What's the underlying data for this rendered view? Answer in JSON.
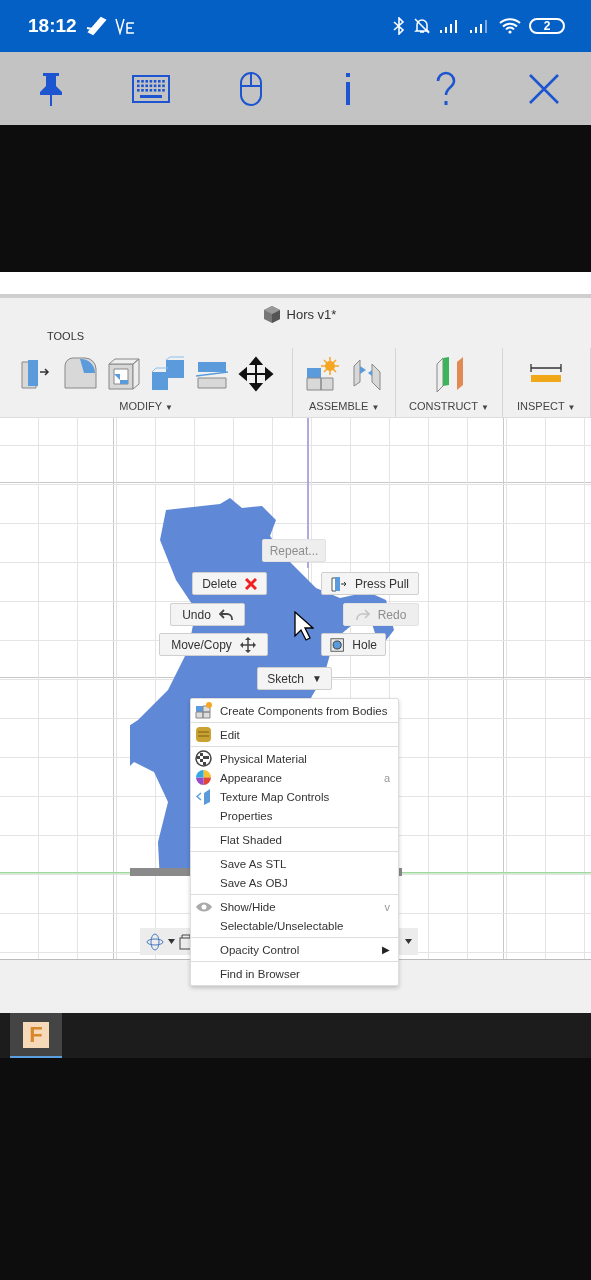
{
  "status_bar": {
    "time": "18:12",
    "battery": "2"
  },
  "app": {
    "title": "Hors v1*",
    "tab": "TOOLS",
    "groups": [
      {
        "label": "MODIFY",
        "caret": "▼"
      },
      {
        "label": "ASSEMBLE",
        "caret": "▼"
      },
      {
        "label": "CONSTRUCT",
        "caret": "▼"
      },
      {
        "label": "INSPECT",
        "caret": "▼"
      }
    ]
  },
  "marking_menu": [
    {
      "label": "Repeat...",
      "kind": "repeat",
      "disabled": true
    },
    {
      "label": "Delete",
      "kind": "delete",
      "disabled": false
    },
    {
      "label": "Press Pull",
      "kind": "press_pull",
      "disabled": false
    },
    {
      "label": "Undo",
      "kind": "undo",
      "disabled": false
    },
    {
      "label": "Redo",
      "kind": "redo",
      "disabled": true
    },
    {
      "label": "Move/Copy",
      "kind": "move",
      "disabled": false
    },
    {
      "label": "Hole",
      "kind": "hole",
      "disabled": false
    },
    {
      "label": "Sketch",
      "kind": "sketch",
      "disabled": false,
      "caret": "▼"
    }
  ],
  "context_menu": [
    [
      {
        "label": "Create Components from Bodies",
        "kind": "components"
      }
    ],
    [
      {
        "label": "Edit",
        "kind": "edit"
      }
    ],
    [
      {
        "label": "Physical Material",
        "kind": "material"
      },
      {
        "label": "Appearance",
        "kind": "appearance",
        "shortcut": "a"
      },
      {
        "label": "Texture Map Controls",
        "kind": "texture"
      },
      {
        "label": "Properties",
        "kind": "plain"
      }
    ],
    [
      {
        "label": "Flat Shaded",
        "kind": "plain"
      }
    ],
    [
      {
        "label": "Save As STL",
        "kind": "plain"
      },
      {
        "label": "Save As OBJ",
        "kind": "plain"
      }
    ],
    [
      {
        "label": "Show/Hide",
        "kind": "eye",
        "shortcut": "v"
      },
      {
        "label": "Selectable/Unselectable",
        "kind": "plain"
      }
    ],
    [
      {
        "label": "Opacity Control",
        "kind": "plain",
        "submenu": "▶"
      }
    ],
    [
      {
        "label": "Find in Browser",
        "kind": "plain"
      }
    ]
  ],
  "taskbar": {
    "app_letter": "F"
  }
}
